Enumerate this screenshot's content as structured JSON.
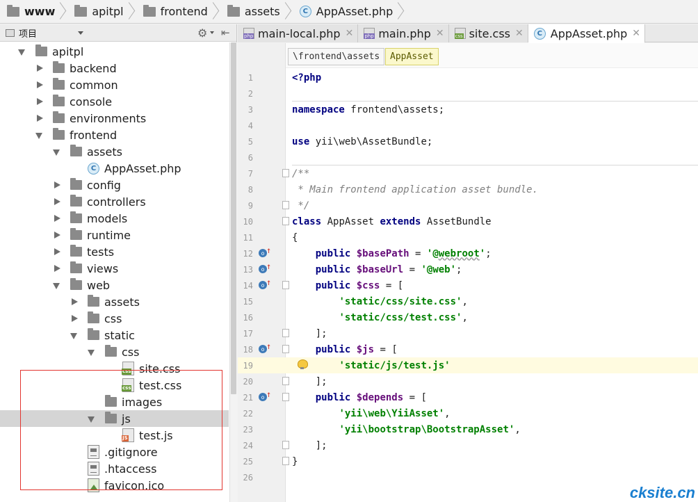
{
  "breadcrumbs": [
    "www",
    "apitpl",
    "frontend",
    "assets",
    "AppAsset.php"
  ],
  "project_panel": {
    "title": "项目"
  },
  "tree": [
    {
      "label": "apitpl",
      "type": "folder",
      "state": "down",
      "depth": 0
    },
    {
      "label": "backend",
      "type": "folder",
      "state": "right",
      "depth": 1
    },
    {
      "label": "common",
      "type": "folder",
      "state": "right",
      "depth": 1
    },
    {
      "label": "console",
      "type": "folder",
      "state": "right",
      "depth": 1
    },
    {
      "label": "environments",
      "type": "folder",
      "state": "right",
      "depth": 1
    },
    {
      "label": "frontend",
      "type": "folder",
      "state": "down",
      "depth": 1
    },
    {
      "label": "assets",
      "type": "folder",
      "state": "down",
      "depth": 2
    },
    {
      "label": "AppAsset.php",
      "type": "class",
      "state": "none",
      "depth": 3
    },
    {
      "label": "config",
      "type": "folder",
      "state": "right",
      "depth": 2
    },
    {
      "label": "controllers",
      "type": "folder",
      "state": "right",
      "depth": 2
    },
    {
      "label": "models",
      "type": "folder",
      "state": "right",
      "depth": 2
    },
    {
      "label": "runtime",
      "type": "folder",
      "state": "right",
      "depth": 2
    },
    {
      "label": "tests",
      "type": "folder",
      "state": "right",
      "depth": 2
    },
    {
      "label": "views",
      "type": "folder",
      "state": "right",
      "depth": 2
    },
    {
      "label": "web",
      "type": "folder",
      "state": "down",
      "depth": 2
    },
    {
      "label": "assets",
      "type": "folder",
      "state": "right",
      "depth": 3
    },
    {
      "label": "css",
      "type": "folder",
      "state": "right",
      "depth": 3
    },
    {
      "label": "static",
      "type": "folder",
      "state": "down",
      "depth": 3
    },
    {
      "label": "css",
      "type": "folder",
      "state": "down",
      "depth": 4
    },
    {
      "label": "site.css",
      "type": "css",
      "state": "none",
      "depth": 5
    },
    {
      "label": "test.css",
      "type": "css",
      "state": "none",
      "depth": 5
    },
    {
      "label": "images",
      "type": "folder",
      "state": "none",
      "depth": 4
    },
    {
      "label": "js",
      "type": "folder",
      "state": "down",
      "depth": 4,
      "selected": true
    },
    {
      "label": "test.js",
      "type": "js",
      "state": "none",
      "depth": 5
    },
    {
      "label": ".gitignore",
      "type": "txt",
      "state": "none",
      "depth": 3
    },
    {
      "label": ".htaccess",
      "type": "txt",
      "state": "none",
      "depth": 3
    },
    {
      "label": "favicon.ico",
      "type": "img",
      "state": "none",
      "depth": 3
    }
  ],
  "tabs": [
    {
      "label": "main-local.php",
      "icon": "php",
      "active": false
    },
    {
      "label": "main.php",
      "icon": "php",
      "active": false
    },
    {
      "label": "site.css",
      "icon": "css",
      "active": false
    },
    {
      "label": "AppAsset.php",
      "icon": "class",
      "active": true
    }
  ],
  "editor_breadcrumb": {
    "namespace": "\\frontend\\assets",
    "class": "AppAsset"
  },
  "code_lines": [
    {
      "n": "1",
      "html": "<span class='kw'>&lt;?php</span>"
    },
    {
      "n": "2",
      "html": ""
    },
    {
      "n": "3",
      "html": "<span class='kw'>namespace</span> frontend\\assets;"
    },
    {
      "n": "4",
      "html": ""
    },
    {
      "n": "5",
      "html": "<span class='kw'>use</span> yii\\web\\AssetBundle;"
    },
    {
      "n": "6",
      "html": ""
    },
    {
      "n": "7",
      "html": "<span class='cm'>/**</span>"
    },
    {
      "n": "8",
      "html": "<span class='cm'> * Main frontend application asset bundle.</span>"
    },
    {
      "n": "9",
      "html": "<span class='cm'> */</span>"
    },
    {
      "n": "10",
      "html": "<span class='kw'>class</span> AppAsset <span class='kw'>extends</span> AssetBundle"
    },
    {
      "n": "11",
      "html": "{"
    },
    {
      "n": "12",
      "html": "    <span class='kw'>public</span> <span class='var'>$basePath</span> = <span class='str'>'@<span class=\"ul\">webroot</span>'</span>;"
    },
    {
      "n": "13",
      "html": "    <span class='kw'>public</span> <span class='var'>$baseUrl</span> = <span class='str'>'@web'</span>;"
    },
    {
      "n": "14",
      "html": "    <span class='kw'>public</span> <span class='var'>$css</span> = ["
    },
    {
      "n": "15",
      "html": "        <span class='str'>'static/css/site.css'</span>,"
    },
    {
      "n": "16",
      "html": "        <span class='str'>'static/css/test.css'</span>,"
    },
    {
      "n": "17",
      "html": "    ];"
    },
    {
      "n": "18",
      "html": "    <span class='kw'>public</span> <span class='var'>$js</span> = ["
    },
    {
      "n": "19",
      "html": "        <span class='str'>'static/js/test.js'</span>"
    },
    {
      "n": "20",
      "html": "    ];"
    },
    {
      "n": "21",
      "html": "    <span class='kw'>public</span> <span class='var'>$depends</span> = ["
    },
    {
      "n": "22",
      "html": "        <span class='str'>'yii\\web\\YiiAsset'</span>,"
    },
    {
      "n": "23",
      "html": "        <span class='str'>'yii\\bootstrap\\BootstrapAsset'</span>,"
    },
    {
      "n": "24",
      "html": "    ];"
    },
    {
      "n": "25",
      "html": "}"
    },
    {
      "n": "26",
      "html": ""
    }
  ],
  "watermark": "cksite.cn"
}
